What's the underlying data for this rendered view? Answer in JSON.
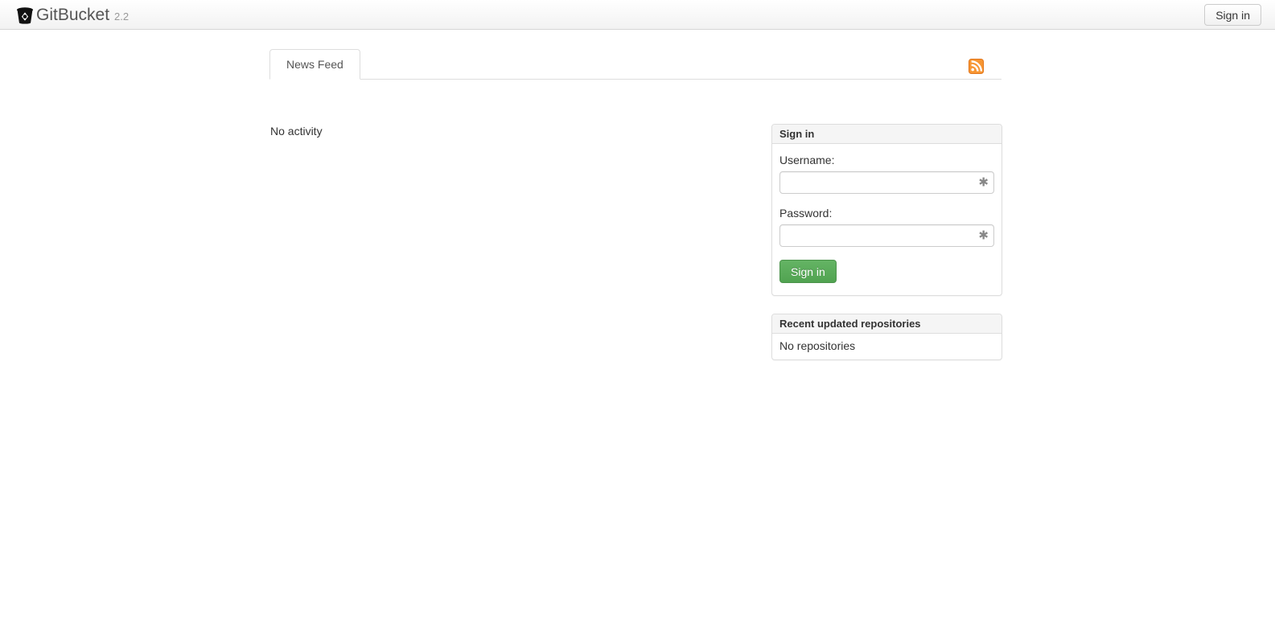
{
  "header": {
    "brand_icon": "bucket-icon",
    "brand_name": "GitBucket",
    "version": "2.2",
    "signin_label": "Sign in"
  },
  "tabs": [
    {
      "label": "News Feed",
      "active": true
    }
  ],
  "feed": {
    "rss_icon": "rss-icon",
    "empty_message": "No activity"
  },
  "sidebar": {
    "signin_panel": {
      "title": "Sign in",
      "username_label": "Username:",
      "username_value": "",
      "username_placeholder": "",
      "username_required_mark": "✱",
      "password_label": "Password:",
      "password_value": "",
      "password_placeholder": "",
      "password_required_mark": "✱",
      "submit_label": "Sign in"
    },
    "repos_panel": {
      "title": "Recent updated repositories",
      "empty_message": "No repositories"
    }
  },
  "colors": {
    "accent_green": "#51a351",
    "rss_orange": "#f08a24",
    "header_bg": "#f7f7f7",
    "border": "#dddddd",
    "panel_heading_bg": "#f5f5f5"
  }
}
